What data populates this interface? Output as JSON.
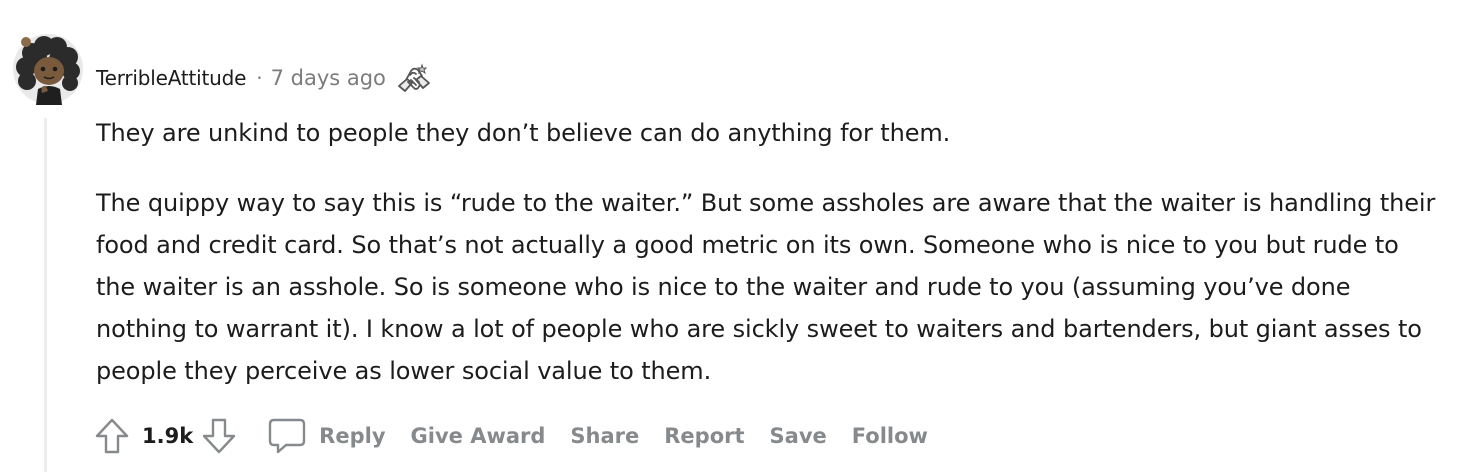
{
  "comment": {
    "username": "TerribleAttitude",
    "separator": "·",
    "time": "7 days ago",
    "award_icon": "award-handshake-icon",
    "avatar_icon": "avatar-icon",
    "paragraphs": [
      "They are unkind to people they don’t believe can do anything for them.",
      "The quippy way to say this is “rude to the waiter.” But some assholes are aware that the waiter is handling their food and credit card. So that’s not actually a good metric on its own. Someone who is nice to you but rude to the waiter is an asshole. So is someone who is nice to the waiter and rude to you (assuming you’ve done nothing to warrant it). I know a lot of people who are sickly sweet to waiters and bartenders, but giant asses to people they perceive as lower social value to them."
    ]
  },
  "actions": {
    "score": "1.9k",
    "reply": "Reply",
    "give_award": "Give Award",
    "share": "Share",
    "report": "Report",
    "save": "Save",
    "follow": "Follow"
  },
  "colors": {
    "text": "#1c1c1c",
    "meta": "#7c7c7c",
    "action": "#878a8c",
    "thread_line": "#ededed"
  }
}
